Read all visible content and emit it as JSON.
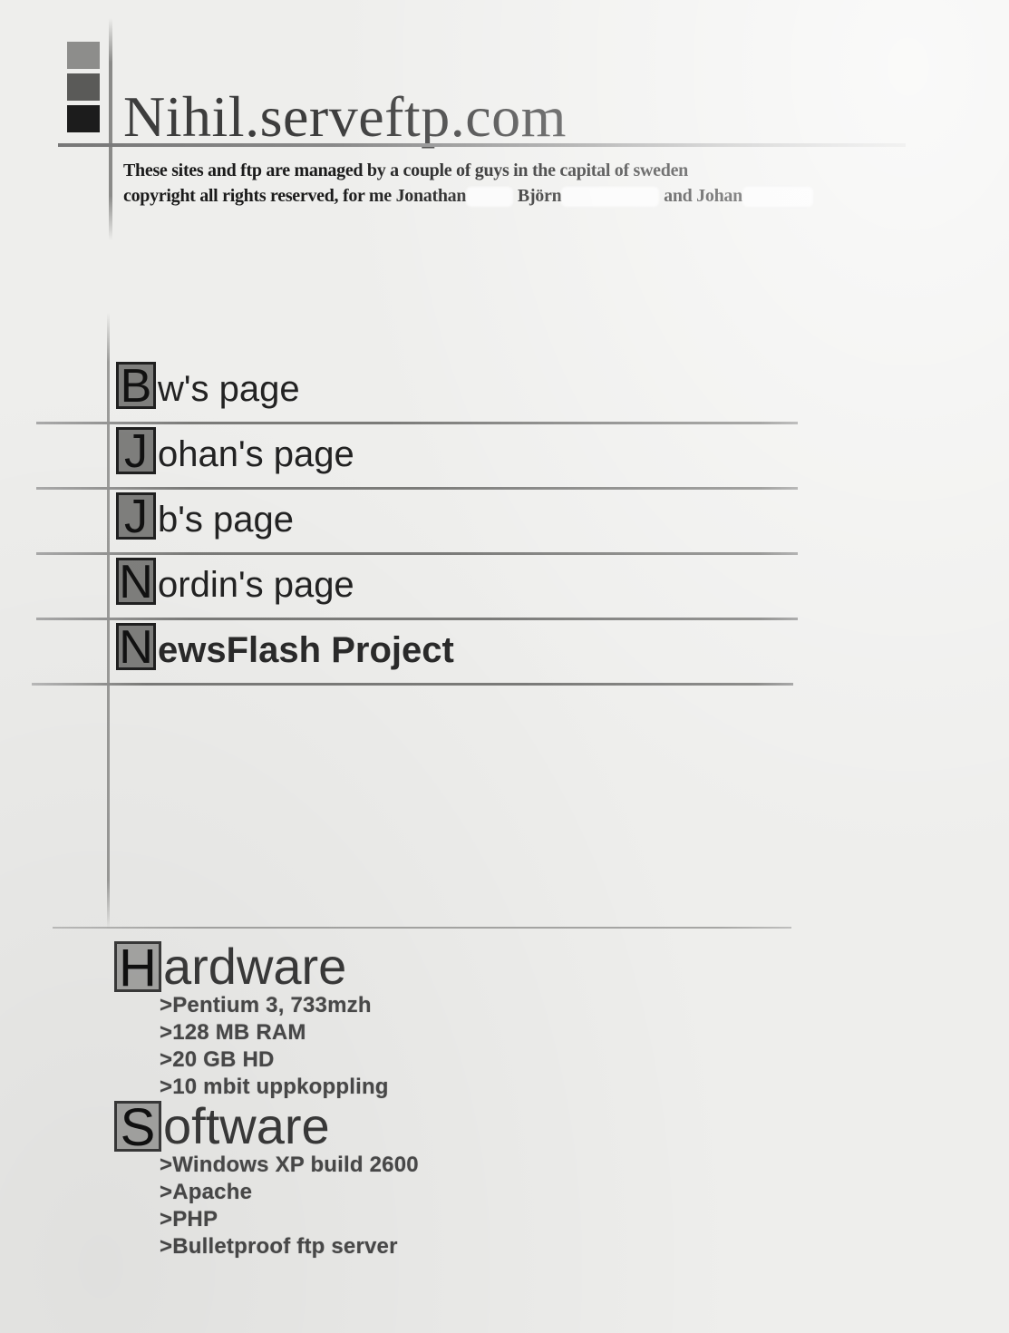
{
  "header": {
    "title": "Nihil.serveftp.com",
    "tagline_line1": "These sites and ftp are managed by a couple of guys in the capital of sweden",
    "tagline_line2_a": "copyright all rights reserved, for me Jonathan",
    "tagline_line2_b": "Björn",
    "tagline_line2_c": "and Johan"
  },
  "nav": {
    "items": [
      {
        "initial": "B",
        "rest": "w's page"
      },
      {
        "initial": "J",
        "rest": "ohan's page"
      },
      {
        "initial": "J",
        "rest": "b's page"
      },
      {
        "initial": "N",
        "rest": "ordin's page"
      },
      {
        "initial": "N",
        "rest": "ewsFlash Project"
      }
    ]
  },
  "hardware": {
    "initial": "H",
    "rest": "ardware",
    "items": [
      ">Pentium 3, 733mzh",
      ">128 MB RAM",
      ">20 GB HD",
      ">10 mbit uppkoppling"
    ]
  },
  "software": {
    "initial": "S",
    "rest": "oftware",
    "items": [
      ">Windows XP build 2600",
      ">Apache",
      ">PHP",
      ">Bulletproof ftp server"
    ]
  },
  "colors": {
    "background": "#eeeeec",
    "text": "#1a1a1a",
    "initial_box": "#7f7f7d",
    "rule": "#7b7b79"
  }
}
